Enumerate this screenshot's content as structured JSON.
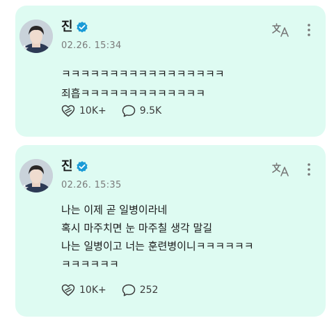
{
  "posts": [
    {
      "author": "진",
      "date": "02.26. 15:34",
      "lines": [
        "ㅋㅋㅋㅋㅋㅋㅋㅋㅋㅋㅋㅋㅋㅋㅋㅋㅋ",
        "죄흡ㅋㅋㅋㅋㅋㅋㅋㅋㅋㅋㅋㅋㅋ"
      ],
      "likes": "10K+",
      "comments": "9.5K"
    },
    {
      "author": "진",
      "date": "02.26. 15:35",
      "lines": [
        "나는 이제 곧 일병이라네",
        "혹시 마주치면 눈 마주칠 생각 말길",
        "나는 일병이고 너는 훈련병이니ㅋㅋㅋㅋㅋㅋ",
        "ㅋㅋㅋㅋㅋㅋ"
      ],
      "likes": "10K+",
      "comments": "252"
    }
  ],
  "icons": {
    "verified": "verified-badge-icon",
    "translate": "translate-icon",
    "more": "more-vertical-icon",
    "like": "heart-bandage-icon",
    "comment": "comment-bubble-icon"
  },
  "colors": {
    "card_bg": "#defbf2",
    "verified": "#1a9bd7",
    "text": "#1a1a1a",
    "meta": "#7a7a7a"
  }
}
